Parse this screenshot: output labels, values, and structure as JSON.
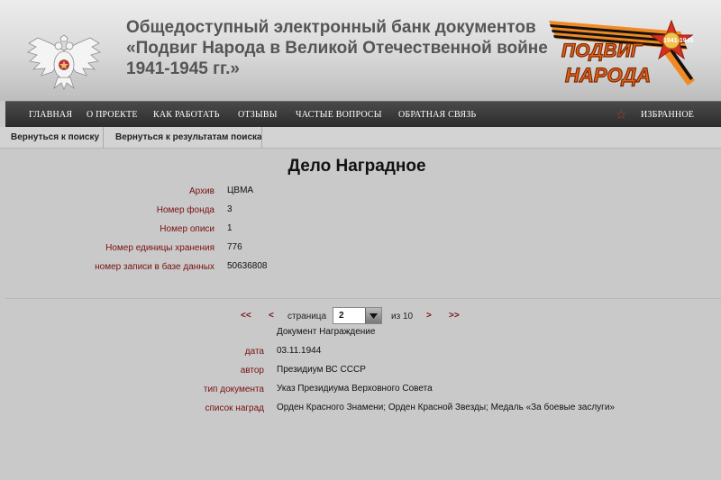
{
  "header": {
    "title_line1": "Общедоступный электронный банк документов",
    "title_line2": "«Подвиг Народа в Великой Отечественной войне",
    "title_line3": "1941-1945 гг.»",
    "logo": {
      "word1": "Подвиг",
      "word2": "Народа",
      "years": "1941-1945"
    }
  },
  "nav": {
    "items": [
      "Главная",
      "О проекте",
      "Как работать",
      "Отзывы",
      "Частые вопросы",
      "Обратная связь"
    ],
    "favorites": "Избранное"
  },
  "subnav": {
    "back_to_search": "Вернуться к поиску",
    "back_to_results": "Вернуться к результатам поиска"
  },
  "case": {
    "title": "Дело Наградное",
    "fields": [
      {
        "label": "Архив",
        "value": "ЦВМА"
      },
      {
        "label": "Номер фонда",
        "value": "3"
      },
      {
        "label": "Номер описи",
        "value": "1"
      },
      {
        "label": "Номер единицы хранения",
        "value": "776"
      },
      {
        "label": "номер записи в базе данных",
        "value": "50636808"
      }
    ]
  },
  "pagination": {
    "first": "<<",
    "prev": "<",
    "page_label": "страница",
    "current": "2",
    "of_label": "из 10",
    "next": ">",
    "last": ">>"
  },
  "document": {
    "type_title": "Документ Награждение",
    "fields": [
      {
        "label": "дата",
        "value": "03.11.1944"
      },
      {
        "label": "автор",
        "value": "Президиум ВС СССР"
      },
      {
        "label": "тип документа",
        "value": "Указ Президиума Верховного Совета"
      },
      {
        "label": "список наград",
        "value": "Орден Красного Знамени; Орден Красной Звезды; Медаль «За боевые заслуги»"
      }
    ]
  },
  "colors": {
    "label_red": "#7a1010",
    "nav_dark": "#2c2c2c",
    "star_red": "#c0392b",
    "logo_orange": "#e8631a"
  }
}
